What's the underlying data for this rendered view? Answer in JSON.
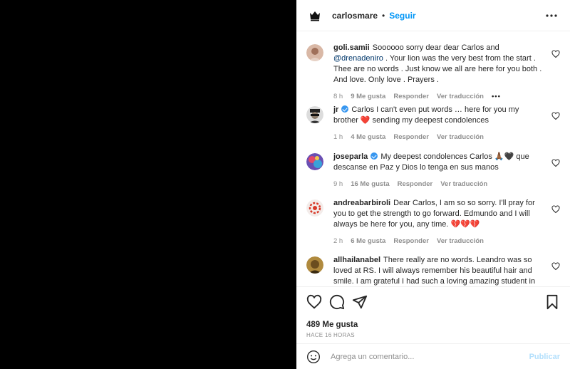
{
  "header": {
    "username": "carlosmare",
    "separator": "•",
    "follow_label": "Seguir"
  },
  "comments": [
    {
      "user": "goli.samii",
      "text_before": "Soooooo sorry dear dear Carlos and ",
      "mention": "@drenadeniro",
      "text_after": " . Your lion was the very best from the start . Thee are no words . Just know we all are here for you both . And love. Only love . Prayers .",
      "verified": false,
      "time": "8 h",
      "likes": "9 Me gusta",
      "reply": "Responder",
      "translate": "Ver traducción",
      "more": "•••"
    },
    {
      "user": "jr",
      "text": "Carlos I can't even put words … here for you my brother ❤️ sending my deepest condolences",
      "verified": true,
      "time": "1 h",
      "likes": "4 Me gusta",
      "reply": "Responder",
      "translate": "Ver traducción"
    },
    {
      "user": "joseparla",
      "text": "My deepest condolences Carlos 🙏🏾🖤 que descanse en Paz y Dios lo tenga en sus manos",
      "verified": true,
      "time": "9 h",
      "likes": "16 Me gusta",
      "reply": "Responder",
      "translate": "Ver traducción"
    },
    {
      "user": "andreabarbiroli",
      "text": "Dear Carlos, I am so so sorry. I'll pray for you to get the strength to go forward. Edmundo and I will always be here for you, any time. 💔💔💔",
      "verified": false,
      "time": "2 h",
      "likes": "6 Me gusta",
      "reply": "Responder",
      "translate": "Ver traducción"
    },
    {
      "user": "allhailanabel",
      "text": "There really are no words. Leandro was so loved at RS. I will always remember his beautiful hair and smile. I am grateful I had such a loving amazing student in",
      "verified": false
    }
  ],
  "footer": {
    "likes_count": "489 Me gusta",
    "time_ago": "HACE 16 HORAS",
    "comment_placeholder": "Agrega un comentario...",
    "publish_label": "Publicar"
  },
  "icons": {
    "like": "heart-icon",
    "comment": "comment-icon",
    "share": "share-icon",
    "save": "bookmark-icon",
    "emoji": "emoji-icon",
    "more": "more-options-icon"
  },
  "colors": {
    "link_blue": "#0095f6",
    "mention": "#00376b",
    "muted": "#8e8e8e",
    "publish_disabled": "#b2dffc",
    "verified": "#3897f0"
  }
}
